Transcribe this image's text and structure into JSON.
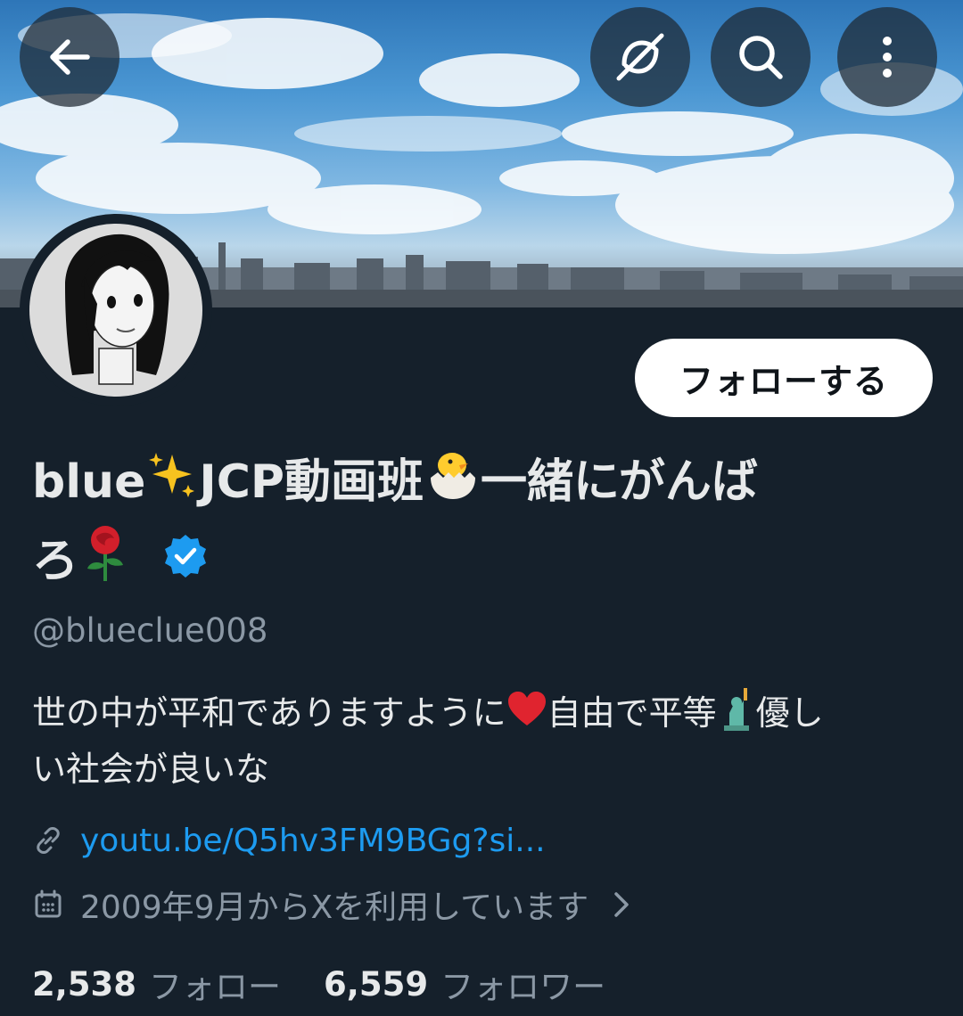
{
  "profile": {
    "display_name_part1": "blue",
    "display_name_part2": "JCP動画班",
    "display_name_part3": "一緒にがんば",
    "display_name_part4": "ろ",
    "handle": "@blueclue008",
    "bio_part1": "世の中が平和でありますように",
    "bio_part2": "自由で平等",
    "bio_part3": "優し",
    "bio_part4": "い社会が良いな",
    "link": "youtu.be/Q5hv3FM9BGg?si...",
    "joined": "2009年9月からXを利用しています",
    "following_count": "2,538",
    "following_label": "フォロー",
    "followers_count": "6,559",
    "followers_label": "フォロワー"
  },
  "actions": {
    "follow_label": "フォローする"
  },
  "icons": {
    "back": "back-arrow-icon",
    "grok": "grok-icon",
    "search": "search-icon",
    "more": "more-vertical-icon",
    "sparkles": "sparkles-emoji",
    "chick": "hatching-chick-emoji",
    "rose": "rose-emoji",
    "verified": "verified-badge-icon",
    "heart": "red-heart-emoji",
    "liberty": "statue-of-liberty-emoji",
    "link": "link-icon",
    "calendar": "calendar-icon",
    "chevron": "chevron-right-icon"
  },
  "colors": {
    "background": "#15202b",
    "accent": "#1d9bf0",
    "muted": "#8b98a5"
  }
}
